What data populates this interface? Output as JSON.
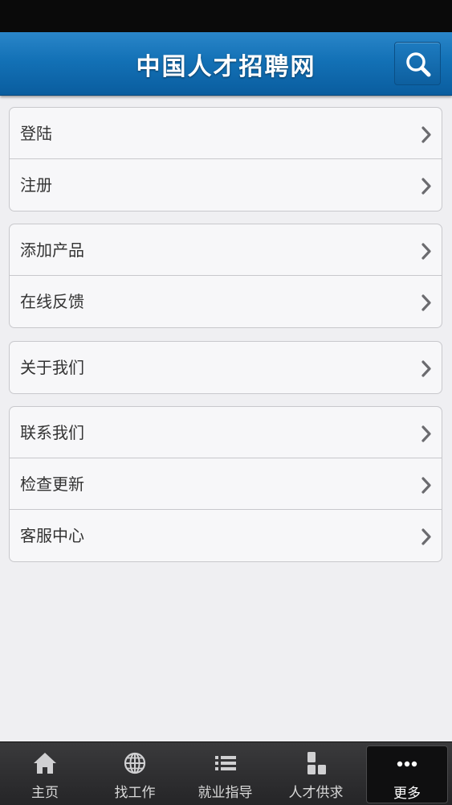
{
  "header": {
    "title": "中国人才招聘网",
    "search_icon": "search-icon"
  },
  "groups": [
    {
      "items": [
        {
          "label": "登陆"
        },
        {
          "label": "注册"
        }
      ]
    },
    {
      "items": [
        {
          "label": "添加产品"
        },
        {
          "label": "在线反馈"
        }
      ]
    },
    {
      "items": [
        {
          "label": "关于我们"
        }
      ]
    },
    {
      "items": [
        {
          "label": "联系我们"
        },
        {
          "label": "检查更新"
        },
        {
          "label": "客服中心"
        }
      ]
    }
  ],
  "tabbar": {
    "tabs": [
      {
        "label": "主页",
        "icon": "home-icon"
      },
      {
        "label": "找工作",
        "icon": "globe-icon"
      },
      {
        "label": "就业指导",
        "icon": "list-icon"
      },
      {
        "label": "人才供求",
        "icon": "blocks-icon"
      },
      {
        "label": "更多",
        "icon": "more-icon",
        "active": true
      }
    ]
  },
  "colors": {
    "header_blue": "#1371b6",
    "background": "#efeff2",
    "tabbar": "#2e2e30"
  }
}
